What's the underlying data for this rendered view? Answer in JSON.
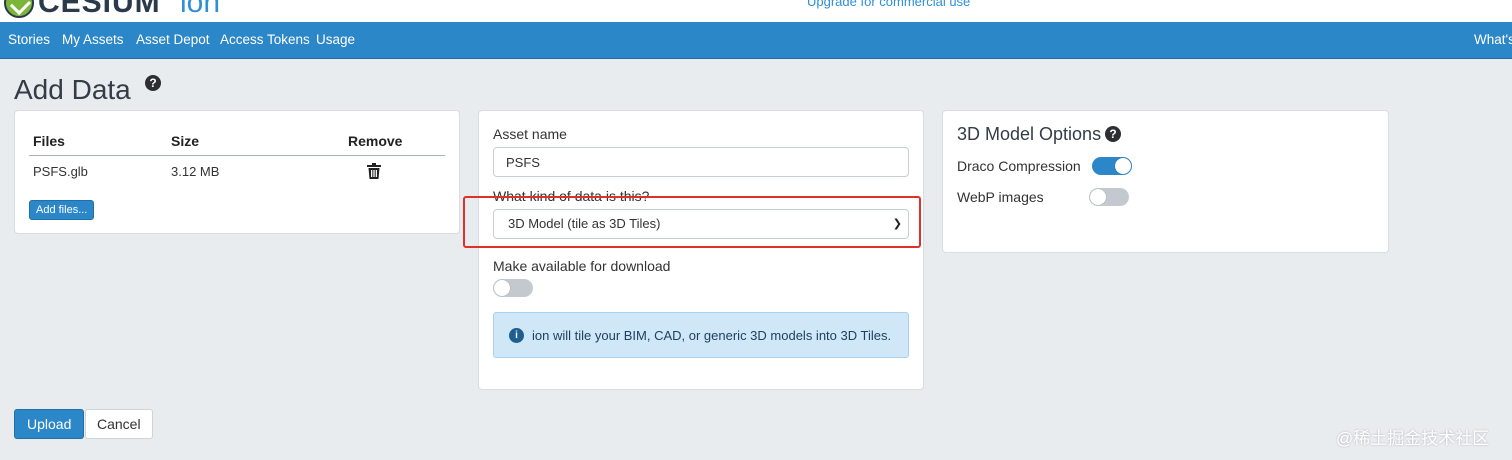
{
  "brand": {
    "logo_text": "CESIUM",
    "logo_suffix": "ion",
    "upgrade_link": "Upgrade for commercial use"
  },
  "nav": {
    "items": [
      "Stories",
      "My Assets",
      "Asset Depot",
      "Access Tokens",
      "Usage"
    ],
    "right": "What's"
  },
  "page": {
    "title": "Add Data",
    "help_glyph": "?"
  },
  "files": {
    "headers": [
      "Files",
      "Size",
      "Remove"
    ],
    "rows": [
      {
        "name": "PSFS.glb",
        "size": "3.12 MB"
      }
    ],
    "add_button": "Add files..."
  },
  "asset": {
    "name_label": "Asset name",
    "name_value": "PSFS",
    "kind_label": "What kind of data is this?",
    "kind_selected": "3D Model (tile as 3D Tiles)",
    "download_label": "Make available for download",
    "download_enabled": false,
    "info_glyph": "i",
    "info_text": "ion will tile your BIM, CAD, or generic 3D models into 3D Tiles."
  },
  "options": {
    "title": "3D Model Options",
    "help_glyph": "?",
    "draco_label": "Draco Compression",
    "draco_enabled": true,
    "webp_label": "WebP images",
    "webp_enabled": false
  },
  "actions": {
    "upload": "Upload",
    "cancel": "Cancel"
  },
  "watermark": "@稀土掘金技术社区",
  "colors": {
    "nav_blue": "#2c87c8",
    "highlight_red": "#e0302a",
    "info_bg": "#cfe7f7"
  }
}
